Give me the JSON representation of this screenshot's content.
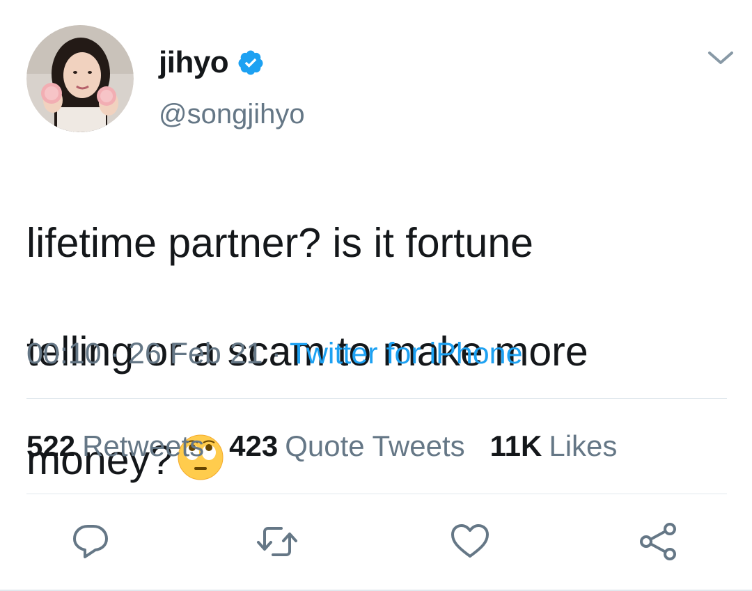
{
  "author": {
    "display_name": "jihyo",
    "handle": "@songjihyo",
    "verified": true,
    "avatar_icon": "profile-photo"
  },
  "tweet": {
    "text_lines": [
      "lifetime partner? is it fortune",
      "telling or a scam to make more",
      "money?"
    ],
    "emoji": "face-with-rolling-eyes"
  },
  "meta": {
    "time": "00:10",
    "separator": "·",
    "date": "26 Feb 21",
    "source": "Twitter for iPhone"
  },
  "stats": {
    "retweets_count": "522",
    "retweets_label": "Retweets",
    "quotes_count": "423",
    "quotes_label": "Quote Tweets",
    "likes_count": "11K",
    "likes_label": "Likes"
  },
  "actions": {
    "reply_icon": "reply-icon",
    "retweet_icon": "retweet-icon",
    "like_icon": "heart-icon",
    "share_icon": "share-icon"
  },
  "colors": {
    "text_primary": "#14171a",
    "text_secondary": "#657786",
    "accent": "#1da1f2",
    "divider": "#e1e8ed"
  }
}
